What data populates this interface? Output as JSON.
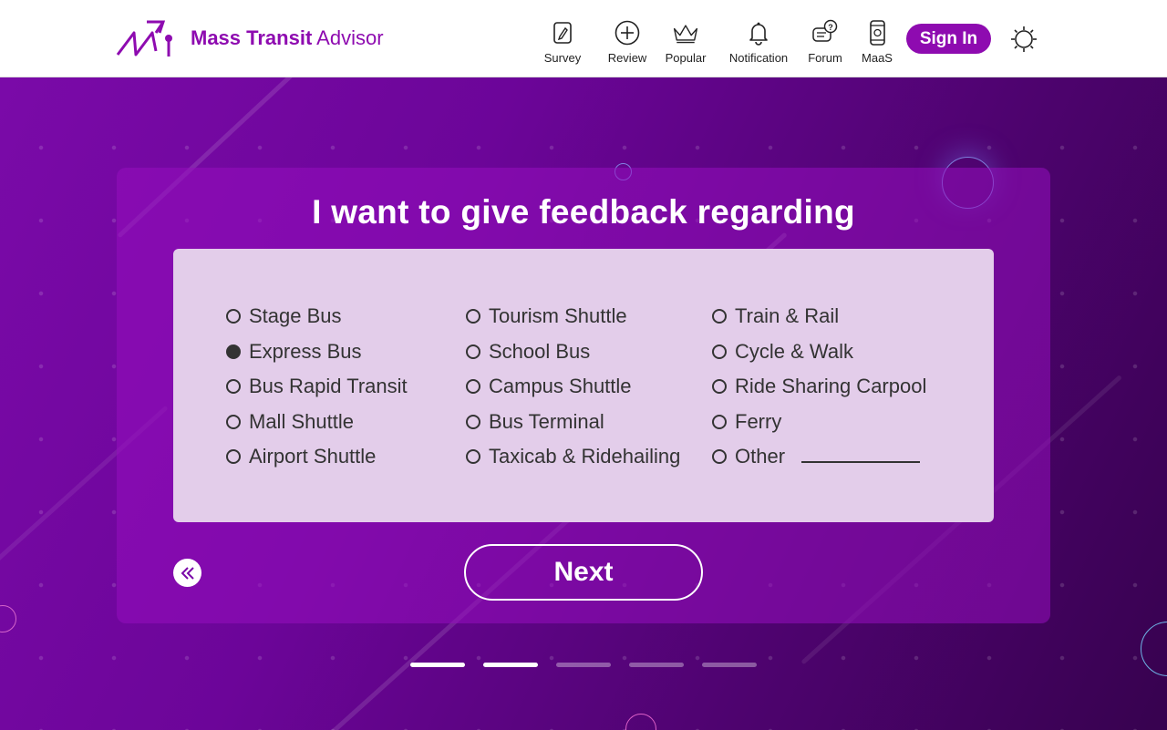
{
  "header": {
    "brand_bold": "Mass Transit",
    "brand_light": " Advisor",
    "nav": [
      {
        "label": "Survey",
        "icon": "survey-icon"
      },
      {
        "label": "Review",
        "icon": "add-circle-icon"
      },
      {
        "label": "Popular",
        "icon": "crown-icon"
      },
      {
        "label": "Notification",
        "icon": "bell-icon"
      },
      {
        "label": "Forum",
        "icon": "chat-question-icon"
      },
      {
        "label": "MaaS",
        "icon": "phone-icon"
      }
    ],
    "signin_label": "Sign In",
    "theme_icon": "sun-icon"
  },
  "survey": {
    "title": "I want to give feedback regarding",
    "columns": [
      [
        {
          "label": "Stage Bus",
          "checked": false
        },
        {
          "label": "Express Bus",
          "checked": true
        },
        {
          "label": "Bus Rapid Transit",
          "checked": false
        },
        {
          "label": "Mall Shuttle",
          "checked": false
        },
        {
          "label": "Airport Shuttle",
          "checked": false
        }
      ],
      [
        {
          "label": "Tourism Shuttle",
          "checked": false
        },
        {
          "label": "School Bus",
          "checked": false
        },
        {
          "label": "Campus Shuttle",
          "checked": false
        },
        {
          "label": "Bus Terminal",
          "checked": false
        },
        {
          "label": "Taxicab & Ridehailing",
          "checked": false
        }
      ],
      [
        {
          "label": "Train & Rail",
          "checked": false
        },
        {
          "label": "Cycle & Walk",
          "checked": false
        },
        {
          "label": "Ride Sharing Carpool",
          "checked": false
        },
        {
          "label": "Ferry",
          "checked": false
        },
        {
          "label": "Other",
          "checked": false
        }
      ]
    ],
    "next_label": "Next",
    "back_icon": "double-chevron-left-icon"
  },
  "pager": {
    "steps": 5,
    "active": [
      0,
      1
    ]
  },
  "colors": {
    "brand": "#8e0bb0",
    "panel": "#e3cdea"
  }
}
